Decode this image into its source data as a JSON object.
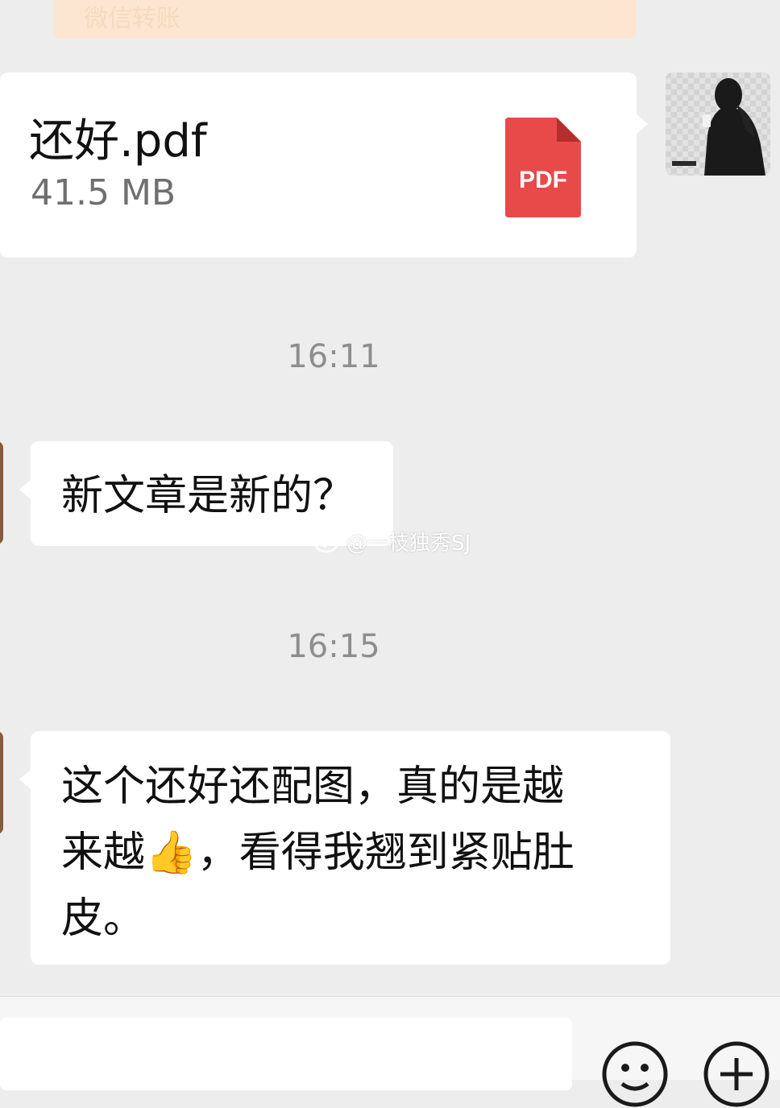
{
  "transfer": {
    "label": "微信转账"
  },
  "file_message": {
    "name": "还好.pdf",
    "size": "41.5 MB",
    "icon": "pdf-file-icon",
    "icon_label": "PDF",
    "icon_color": "#e84a4a"
  },
  "timestamps": [
    "16:11",
    "16:15"
  ],
  "messages": [
    {
      "lines": [
        "新文章是新的？"
      ]
    },
    {
      "lines": [
        "这个还好还配图，真的是越",
        "来越👍，看得我翘到紧贴肚",
        "皮。"
      ]
    }
  ],
  "watermark": {
    "text": "@一枝独秀SJ",
    "icon": "weibo-icon"
  },
  "input_bar": {
    "emoji_icon": "smiley-icon",
    "plus_icon": "plus-icon"
  },
  "colors": {
    "background": "#ededed",
    "bubble": "#ffffff",
    "transfer_card": "#fce6d2",
    "timestamp": "#8e8e8e"
  }
}
